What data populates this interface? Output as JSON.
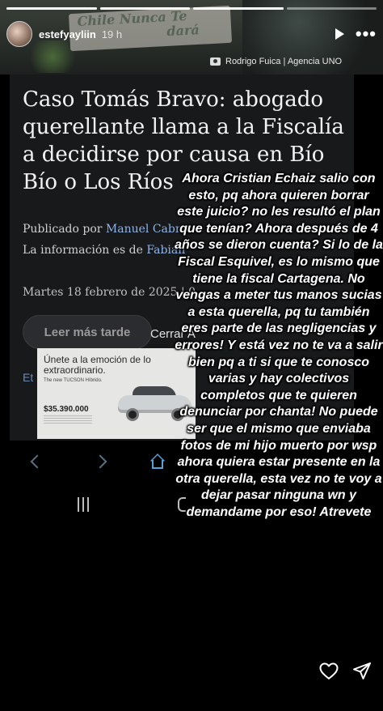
{
  "story": {
    "progress_segments": [
      1.0,
      1.0,
      1.0,
      0.0
    ],
    "username": "estefyayliin",
    "time": "19 h",
    "banner_sign_text": [
      "Chile Nunca Te",
      "dará"
    ],
    "photo_credit": "Rodrigo Fuica | Agencia UNO"
  },
  "article": {
    "title": "Caso Tomás Bravo: abogado querellante llama a la Fiscalía a decidirse por causa en Bío Bío o Los Ríos",
    "published_prefix": "Publicado por",
    "author": "Manuel Cabrer",
    "info_prefix": "La información es de",
    "source": "Fabián",
    "date": "Martes 18 febrero de 2025 | 0",
    "later_button": "Leer más tarde",
    "close_text": "Cerrar A",
    "et_text": "Et",
    "ad": {
      "headline": "Únete a la emoción de lo extraordinario.",
      "subline": "The new TUCSON Híbrido.",
      "price": "$35.390.000"
    }
  },
  "overlay_text": "Ahora Cristian Echaiz salio con esto, pq ahora quieren borrar este juicio? no les resultó el plan que tenían? Ahora después de 4 años se dieron cuenta? Si lo de la Fiscal Esquivel, es lo mismo que tiene la fiscal Cartagena. No vengas a meter tus manos sucias a esta querella, pq tu también eres parte de las negligencias y errores! Y está vez no te va a salir bien pq a ti si que te conosco varias y hay colectivos completos que te quieren denunciar por chanta! No puede ser que el mismo que enviaba fotos de mi hijo muerto por wsp ahora quiera estar presente en la otra querella, esta vez no te voy a dejar pasar ninguna wn y demandame por eso! Atrevete",
  "icons": [
    "play-icon",
    "more-icon",
    "camera-icon",
    "back-icon",
    "forward-icon",
    "home-icon",
    "heart-icon",
    "send-icon"
  ],
  "colors": {
    "background": "#000000",
    "link": "#8fb4e8",
    "home_icon": "#5aa0d8"
  }
}
